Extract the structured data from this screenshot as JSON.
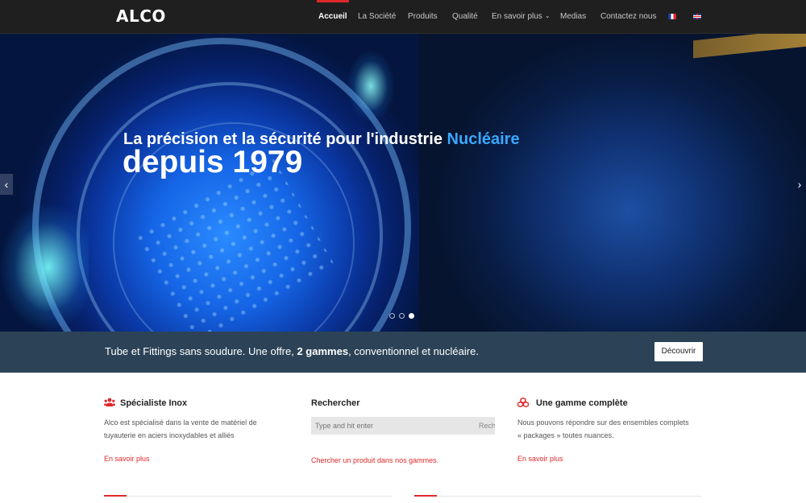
{
  "header": {
    "logo": "ALCO",
    "nav": [
      {
        "label": "Accueil",
        "active": true
      },
      {
        "label": "La Société",
        "active": false
      },
      {
        "label": "Produits",
        "active": false
      },
      {
        "label": "Qualité",
        "active": false
      },
      {
        "label": "En savoir plus",
        "active": false,
        "has_dropdown": true
      },
      {
        "label": "Medias",
        "active": false
      },
      {
        "label": "Contactez nous",
        "active": false
      }
    ],
    "languages": [
      "flag-fr-icon",
      "flag-en-icon"
    ]
  },
  "hero": {
    "line1_prefix": "La précision et la sécurité pour l'industrie ",
    "line1_highlight": "Nucléaire",
    "line2": "depuis 1979",
    "slides": 3,
    "active_slide": 3,
    "prev_icon": "chevron-left-icon",
    "next_icon": "chevron-right-icon"
  },
  "banner": {
    "text_prefix": "Tube et Fittings sans soudure. Une offre, ",
    "text_bold": "2 gammes",
    "text_suffix": ", conventionnel et nucléaire.",
    "button": "Découvrir"
  },
  "features": {
    "specialist": {
      "title": "Spécialiste Inox",
      "icon": "users-icon",
      "line1": "Alco est spécialisé dans la vente de matériel de",
      "line2": "tuyauterie en aciers inoxydables et alliés",
      "link": "En savoir plus"
    },
    "search": {
      "title": "Rechercher",
      "placeholder": "Type and hit enter",
      "button_fragment": "Rech",
      "link": "Chercher un produit dans nos gammes."
    },
    "range": {
      "title": "Une gamme complète",
      "icon": "cubes-icon",
      "line1": "Nous pouvons répondre sur des ensembles complets",
      "line2": "« packages » toutes nuances.",
      "link": "En savoir plus"
    }
  },
  "colors": {
    "accent": "#e0282a",
    "header_bg": "#1f1f1f",
    "banner_bg": "#2c4357",
    "highlight": "#3aa7ff"
  }
}
